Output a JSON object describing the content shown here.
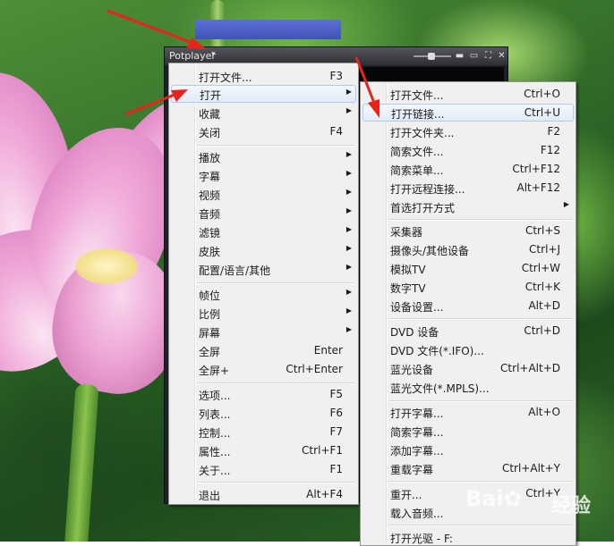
{
  "window": {
    "title": "Potplayer",
    "title_arrow": "▾",
    "buttons": [
      "▬",
      "▭",
      "✕"
    ]
  },
  "main_menu": {
    "items": [
      {
        "label": "打开文件...",
        "shortcut": "F3",
        "submenu": false
      },
      {
        "label": "打开",
        "shortcut": "",
        "submenu": true,
        "highlighted": true
      },
      {
        "label": "收藏",
        "shortcut": "",
        "submenu": true
      },
      {
        "label": "关闭",
        "shortcut": "F4",
        "submenu": false
      },
      {
        "label": "播放",
        "shortcut": "",
        "submenu": true
      },
      {
        "label": "字幕",
        "shortcut": "",
        "submenu": true
      },
      {
        "label": "视频",
        "shortcut": "",
        "submenu": true
      },
      {
        "label": "音频",
        "shortcut": "",
        "submenu": true
      },
      {
        "label": "滤镜",
        "shortcut": "",
        "submenu": true
      },
      {
        "label": "皮肤",
        "shortcut": "",
        "submenu": true
      },
      {
        "label": "配置/语言/其他",
        "shortcut": "",
        "submenu": true
      },
      {
        "label": "帧位",
        "shortcut": "",
        "submenu": true
      },
      {
        "label": "比例",
        "shortcut": "",
        "submenu": true
      },
      {
        "label": "屏幕",
        "shortcut": "",
        "submenu": true
      },
      {
        "label": "全屏",
        "shortcut": "Enter",
        "submenu": false
      },
      {
        "label": "全屏+",
        "shortcut": "Ctrl+Enter",
        "submenu": false
      },
      {
        "label": "选项...",
        "shortcut": "F5",
        "submenu": false
      },
      {
        "label": "列表...",
        "shortcut": "F6",
        "submenu": false
      },
      {
        "label": "控制...",
        "shortcut": "F7",
        "submenu": false
      },
      {
        "label": "属性...",
        "shortcut": "Ctrl+F1",
        "submenu": false
      },
      {
        "label": "关于...",
        "shortcut": "F1",
        "submenu": false
      },
      {
        "label": "退出",
        "shortcut": "Alt+F4",
        "submenu": false
      }
    ]
  },
  "sub_menu": {
    "items": [
      {
        "label": "打开文件...",
        "shortcut": "Ctrl+O"
      },
      {
        "label": "打开链接...",
        "shortcut": "Ctrl+U",
        "highlighted": true
      },
      {
        "label": "打开文件夹...",
        "shortcut": "F2"
      },
      {
        "label": "简索文件...",
        "shortcut": "F12"
      },
      {
        "label": "简索菜单...",
        "shortcut": "Ctrl+F12"
      },
      {
        "label": "打开远程连接...",
        "shortcut": "Alt+F12"
      },
      {
        "label": "首选打开方式",
        "shortcut": "",
        "submenu": true
      },
      {
        "label": "采集器",
        "shortcut": "Ctrl+S"
      },
      {
        "label": "摄像头/其他设备",
        "shortcut": "Ctrl+J"
      },
      {
        "label": "模拟TV",
        "shortcut": "Ctrl+W"
      },
      {
        "label": "数字TV",
        "shortcut": "Ctrl+K"
      },
      {
        "label": "设备设置...",
        "shortcut": "Alt+D"
      },
      {
        "label": "DVD 设备",
        "shortcut": "Ctrl+D"
      },
      {
        "label": "DVD 文件(*.IFO)...",
        "shortcut": ""
      },
      {
        "label": "蓝光设备",
        "shortcut": "Ctrl+Alt+D"
      },
      {
        "label": "蓝光文件(*.MPLS)...",
        "shortcut": ""
      },
      {
        "label": "打开字幕...",
        "shortcut": "Alt+O"
      },
      {
        "label": "简索字幕...",
        "shortcut": ""
      },
      {
        "label": "添加字幕...",
        "shortcut": ""
      },
      {
        "label": "重载字幕",
        "shortcut": "Ctrl+Alt+Y"
      },
      {
        "label": "重开...",
        "shortcut": "Ctrl+Y"
      },
      {
        "label": "载入音频...",
        "shortcut": ""
      },
      {
        "label": "打开光驱 - F:",
        "shortcut": ""
      }
    ]
  },
  "watermark": {
    "logo": "Bai✿",
    "text": "经验"
  }
}
